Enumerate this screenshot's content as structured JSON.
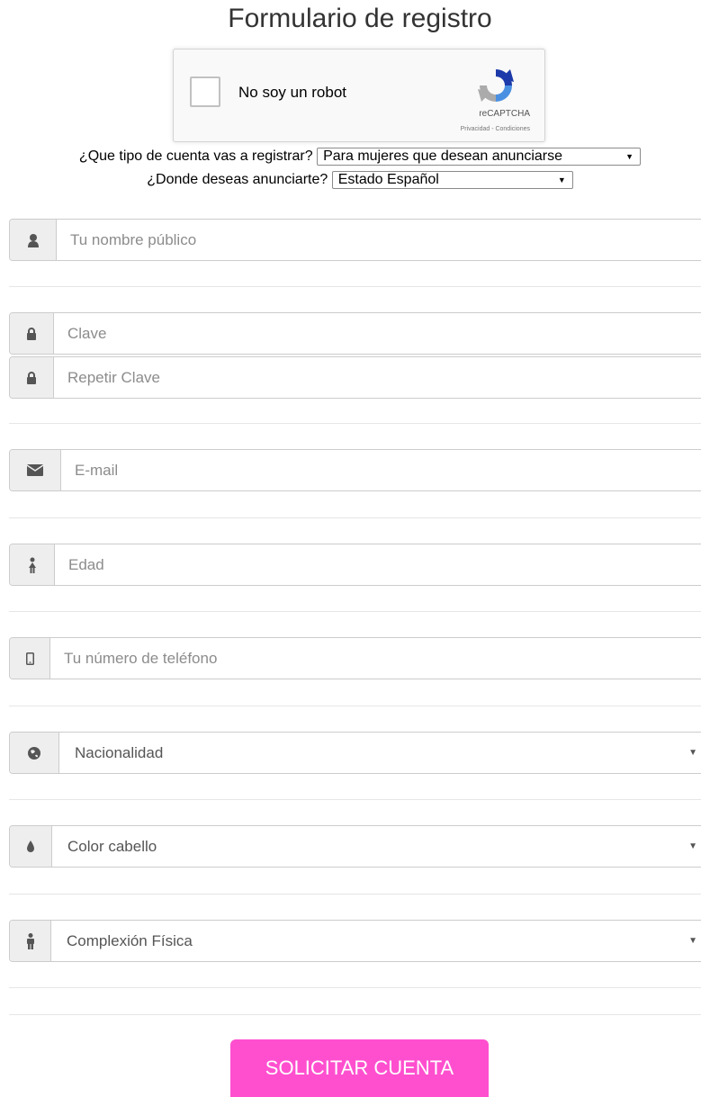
{
  "title": "Formulario de registro",
  "captcha": {
    "label": "No soy un robot",
    "brand": "reCAPTCHA",
    "links": "Privacidad - Condiciones"
  },
  "account_type": {
    "question": "¿Que tipo de cuenta vas a registrar?",
    "selected": "Para mujeres que desean anunciarse"
  },
  "location": {
    "question": "¿Donde deseas anunciarte?",
    "selected": "Estado Español"
  },
  "fields": {
    "public_name": {
      "placeholder": "Tu nombre público",
      "value": "",
      "icon": "user-icon"
    },
    "password": {
      "placeholder": "Clave",
      "value": "",
      "icon": "lock-icon"
    },
    "password_repeat": {
      "placeholder": "Repetir Clave",
      "value": "",
      "icon": "lock-icon"
    },
    "email": {
      "placeholder": "E-mail",
      "value": "",
      "icon": "envelope-icon"
    },
    "age": {
      "placeholder": "Edad",
      "value": "",
      "icon": "female-icon"
    },
    "phone": {
      "placeholder": "Tu número de teléfono",
      "value": "",
      "icon": "mobile-icon"
    }
  },
  "selects": {
    "nationality": {
      "selected": "Nacionalidad",
      "icon": "globe-icon"
    },
    "hair_color": {
      "selected": "Color cabello",
      "icon": "drop-icon"
    },
    "build": {
      "selected": "Complexión Física",
      "icon": "male-icon"
    }
  },
  "submit_label": "SOLICITAR CUENTA",
  "colors": {
    "submit": "#ff4fcf",
    "addon_bg": "#eeeeee",
    "border": "#cccccc",
    "captcha_blue": "#4a90e2"
  }
}
